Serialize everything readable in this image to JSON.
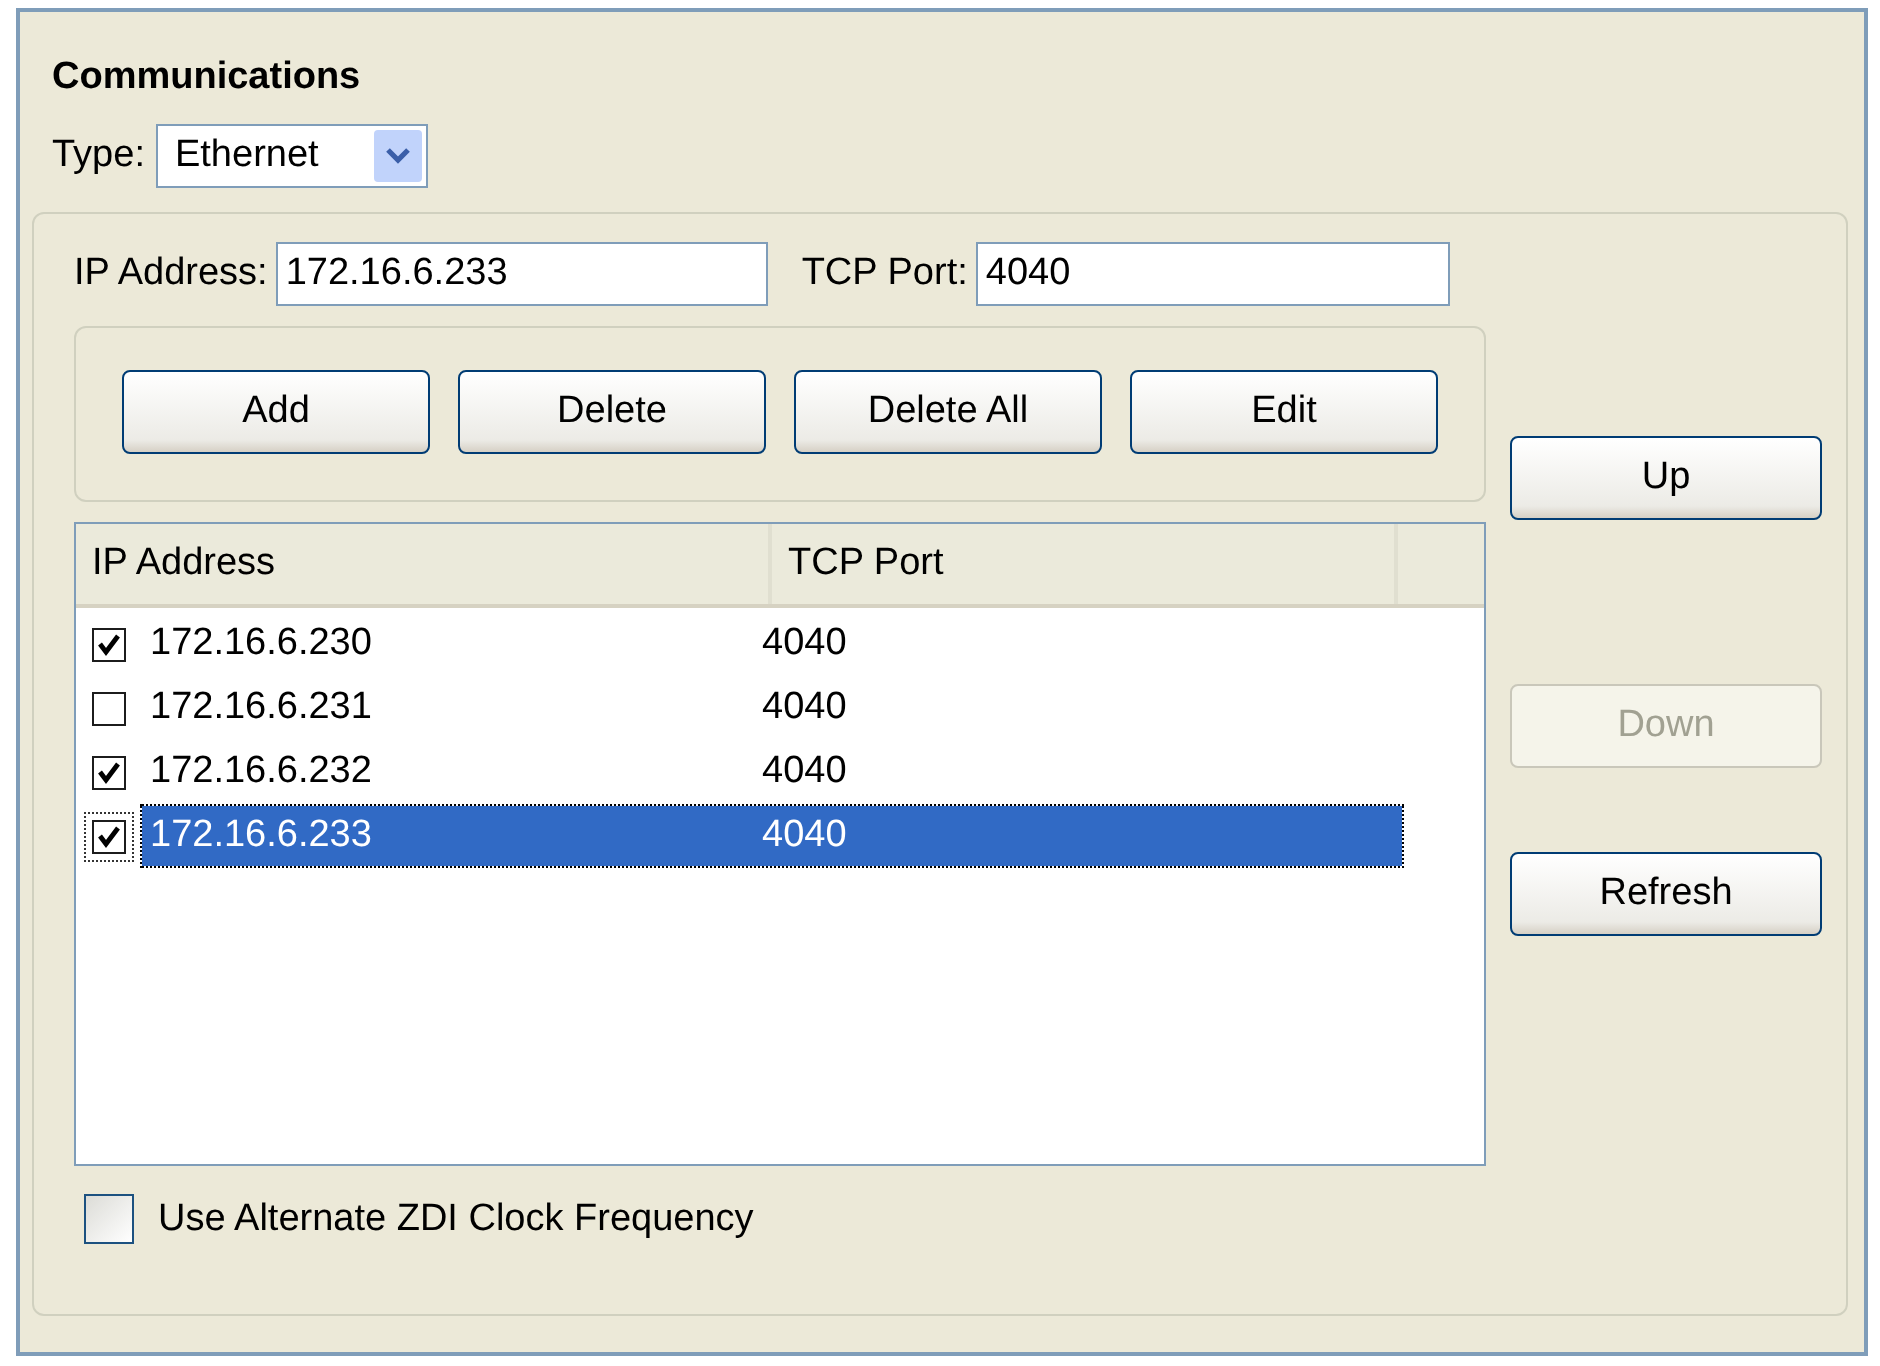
{
  "section_title": "Communications",
  "type_field": {
    "label": "Type:",
    "value": "Ethernet"
  },
  "ip_address": {
    "label": "IP Address:",
    "value": "172.16.6.233"
  },
  "tcp_port": {
    "label": "TCP Port:",
    "value": "4040"
  },
  "action_buttons": [
    {
      "label": "Add",
      "disabled": false
    },
    {
      "label": "Delete",
      "disabled": false
    },
    {
      "label": "Delete All",
      "disabled": false
    },
    {
      "label": "Edit",
      "disabled": false
    }
  ],
  "table": {
    "columns": [
      "IP Address",
      "TCP Port"
    ],
    "rows": [
      {
        "checked": true,
        "selected": false,
        "cells": [
          "172.16.6.230",
          "4040"
        ]
      },
      {
        "checked": false,
        "selected": false,
        "cells": [
          "172.16.6.231",
          "4040"
        ]
      },
      {
        "checked": true,
        "selected": false,
        "cells": [
          "172.16.6.232",
          "4040"
        ]
      },
      {
        "checked": true,
        "selected": true,
        "cells": [
          "172.16.6.233",
          "4040"
        ]
      }
    ]
  },
  "side_buttons": [
    {
      "label": "Up",
      "disabled": false
    },
    {
      "label": "Down",
      "disabled": true
    },
    {
      "label": "Refresh",
      "disabled": false
    }
  ],
  "alternate_clock": {
    "label": "Use Alternate ZDI Clock Frequency",
    "checked": false
  }
}
